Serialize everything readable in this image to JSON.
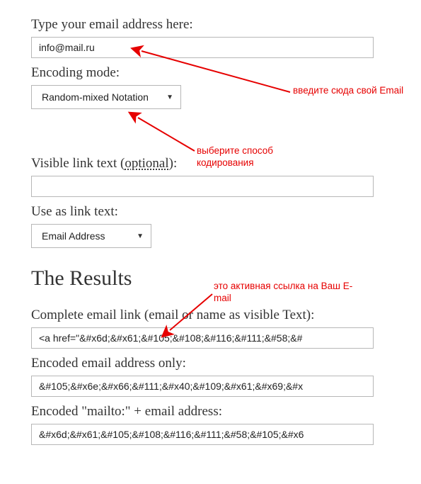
{
  "form": {
    "email_label": "Type your email address here:",
    "email_value": "info@mail.ru",
    "encoding_label": "Encoding mode:",
    "encoding_value": "Random-mixed Notation",
    "visible_link_label_pre": "Visible link text (",
    "visible_link_label_opt": "optional",
    "visible_link_label_post": "):",
    "visible_link_value": "",
    "use_as_link_label": "Use as link text:",
    "use_as_link_value": "Email Address"
  },
  "results": {
    "heading": "The Results",
    "complete_label": "Complete email link (email or name as visible Text):",
    "complete_value": "<a href=\"&#x6d;&#x61;&#105;&#108;&#116;&#111;&#58;&#",
    "encoded_label": "Encoded email address only:",
    "encoded_value": "&#105;&#x6e;&#x66;&#111;&#x40;&#109;&#x61;&#x69;&#x",
    "mailto_label": "Encoded \"mailto:\" + email address:",
    "mailto_value": "&#x6d;&#x61;&#105;&#108;&#116;&#111;&#58;&#105;&#x6"
  },
  "annotations": {
    "a1": "введите сюда свой Email",
    "a2": "выберите способ кодирования",
    "a3": "это активная ссылка на Ваш E-mail"
  }
}
